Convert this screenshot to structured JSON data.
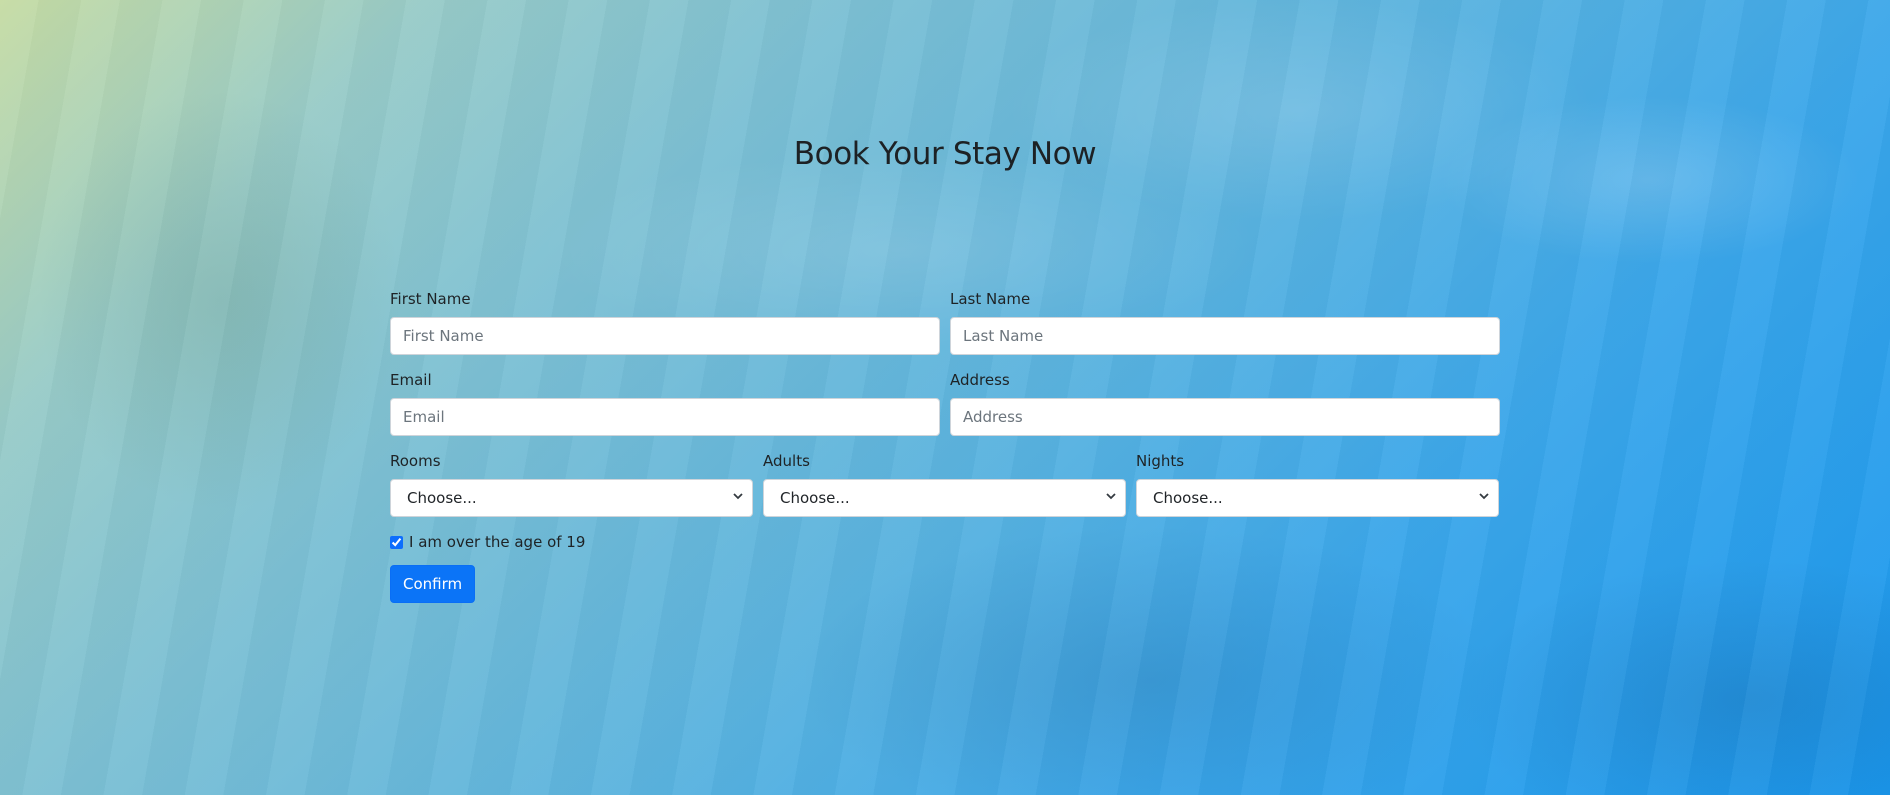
{
  "title": "Book Your Stay Now",
  "form": {
    "first_name": {
      "label": "First Name",
      "placeholder": "First Name"
    },
    "last_name": {
      "label": "Last Name",
      "placeholder": "Last Name"
    },
    "email": {
      "label": "Email",
      "placeholder": "Email"
    },
    "address": {
      "label": "Address",
      "placeholder": "Address"
    },
    "rooms": {
      "label": "Rooms",
      "selected": "Choose..."
    },
    "adults": {
      "label": "Adults",
      "selected": "Choose..."
    },
    "nights": {
      "label": "Nights",
      "selected": "Choose..."
    },
    "age_check": {
      "label": "I am over the age of 19",
      "checked": true
    },
    "confirm_label": "Confirm"
  },
  "colors": {
    "accent": "#0b74f7",
    "background_start": "#c6dca4",
    "background_end": "#1a98ee"
  }
}
